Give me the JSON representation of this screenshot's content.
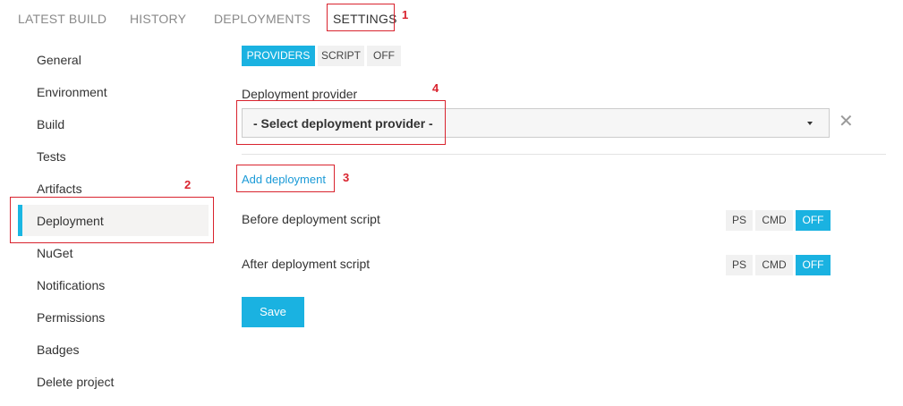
{
  "top_tabs": [
    {
      "label": "LATEST BUILD"
    },
    {
      "label": "HISTORY"
    },
    {
      "label": "DEPLOYMENTS"
    },
    {
      "label": "SETTINGS"
    }
  ],
  "sidebar": {
    "items": [
      {
        "label": "General"
      },
      {
        "label": "Environment"
      },
      {
        "label": "Build"
      },
      {
        "label": "Tests"
      },
      {
        "label": "Artifacts"
      },
      {
        "label": "Deployment"
      },
      {
        "label": "NuGet"
      },
      {
        "label": "Notifications"
      },
      {
        "label": "Permissions"
      },
      {
        "label": "Badges"
      },
      {
        "label": "Delete project"
      }
    ],
    "active": "Deployment"
  },
  "mode_toggle": {
    "options": [
      "PROVIDERS",
      "SCRIPT",
      "OFF"
    ],
    "selected": "PROVIDERS"
  },
  "provider": {
    "label": "Deployment provider",
    "select_value": "- Select deployment provider -",
    "clear_icon": "close-icon"
  },
  "add_deployment_label": "Add deployment",
  "scripts": {
    "before": {
      "label": "Before deployment script",
      "options": [
        "PS",
        "CMD",
        "OFF"
      ],
      "selected": "OFF"
    },
    "after": {
      "label": "After deployment script",
      "options": [
        "PS",
        "CMD",
        "OFF"
      ],
      "selected": "OFF"
    }
  },
  "save_label": "Save",
  "annotations": [
    "1",
    "2",
    "3",
    "4"
  ],
  "colors": {
    "accent": "#1ab2e1",
    "link": "#1a9ad7",
    "annotation": "#d9232e"
  }
}
